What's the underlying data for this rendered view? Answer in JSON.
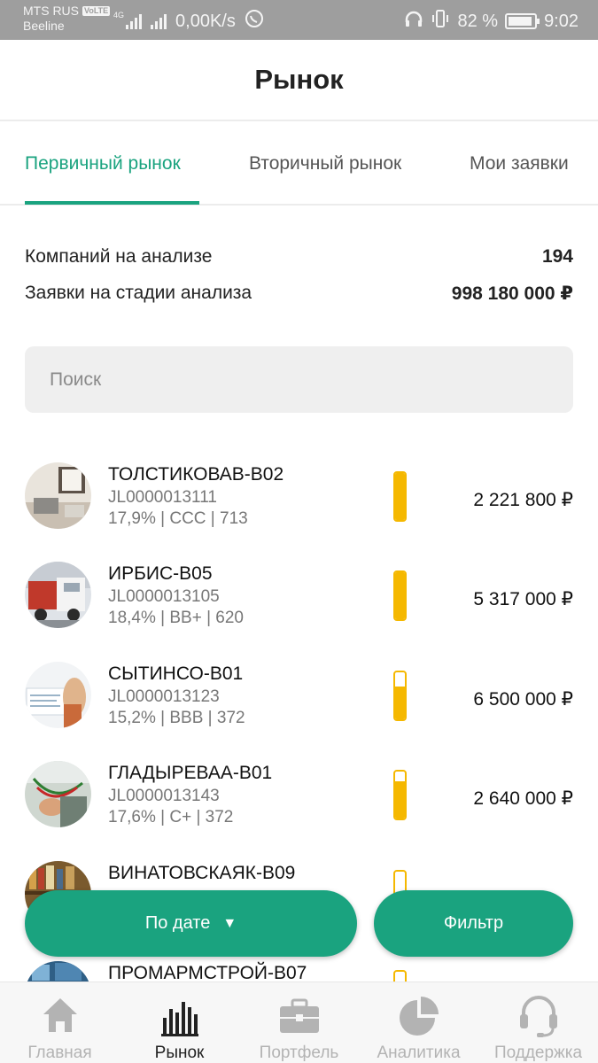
{
  "status_bar": {
    "operator1": "MTS RUS",
    "volte": "VoLTE",
    "network_type": "4G",
    "operator2": "Beeline",
    "speed": "0,00K/s",
    "battery": "82 %",
    "time": "9:02"
  },
  "header": {
    "title": "Рынок"
  },
  "tabs": [
    {
      "label": "Первичный рынок",
      "active": true
    },
    {
      "label": "Вторичный рынок",
      "active": false
    },
    {
      "label": "Мои заявки",
      "active": false
    }
  ],
  "stats": {
    "companies_label": "Компаний на анализе",
    "companies_value": "194",
    "requests_label": "Заявки на стадии анализа",
    "requests_value": "998 180 000 ₽"
  },
  "search": {
    "placeholder": "Поиск"
  },
  "items": [
    {
      "name": "ТОЛСТИКОВАВ-В02",
      "code": "JL0000013111",
      "meta": "17,9% | CCC | 713",
      "amount": "2 221 800 ₽",
      "fill": 1.0,
      "image": "office-desk"
    },
    {
      "name": "ИРБИС-В05",
      "code": "JL0000013105",
      "meta": "18,4% | BB+ | 620",
      "amount": "5 317 000 ₽",
      "fill": 1.0,
      "image": "truck"
    },
    {
      "name": "СЫТИНСО-В01",
      "code": "JL0000013123",
      "meta": "15,2% | BBB | 372",
      "amount": "6 500 000 ₽",
      "fill": 0.7,
      "image": "documents"
    },
    {
      "name": "ГЛАДЫРЕВАА-В01",
      "code": "JL0000013143",
      "meta": "17,6% | C+ | 372",
      "amount": "2 640 000 ₽",
      "fill": 0.8,
      "image": "electrician"
    },
    {
      "name": "ВИНАТОВСКАЯК-В09",
      "code": "",
      "meta": "",
      "amount": "",
      "fill": 0.1,
      "image": "bookshelf"
    },
    {
      "name": "ПРОМАРМСТРОЙ-В07",
      "code": "",
      "meta": "",
      "amount": "",
      "fill": 0.1,
      "image": "industrial"
    }
  ],
  "buttons": {
    "sort_label": "По дате",
    "sort_arrow": "▼",
    "filter_label": "Фильтр"
  },
  "bottom_nav": [
    {
      "label": "Главная",
      "icon": "home-icon",
      "active": false
    },
    {
      "label": "Рынок",
      "icon": "bar-chart-icon",
      "active": true
    },
    {
      "label": "Портфель",
      "icon": "briefcase-icon",
      "active": false
    },
    {
      "label": "Аналитика",
      "icon": "pie-chart-icon",
      "active": false
    },
    {
      "label": "Поддержка",
      "icon": "headset-icon",
      "active": false
    }
  ],
  "colors": {
    "accent": "#1aa37f",
    "gauge": "#f5b800",
    "status_bar": "#9e9e9e"
  }
}
